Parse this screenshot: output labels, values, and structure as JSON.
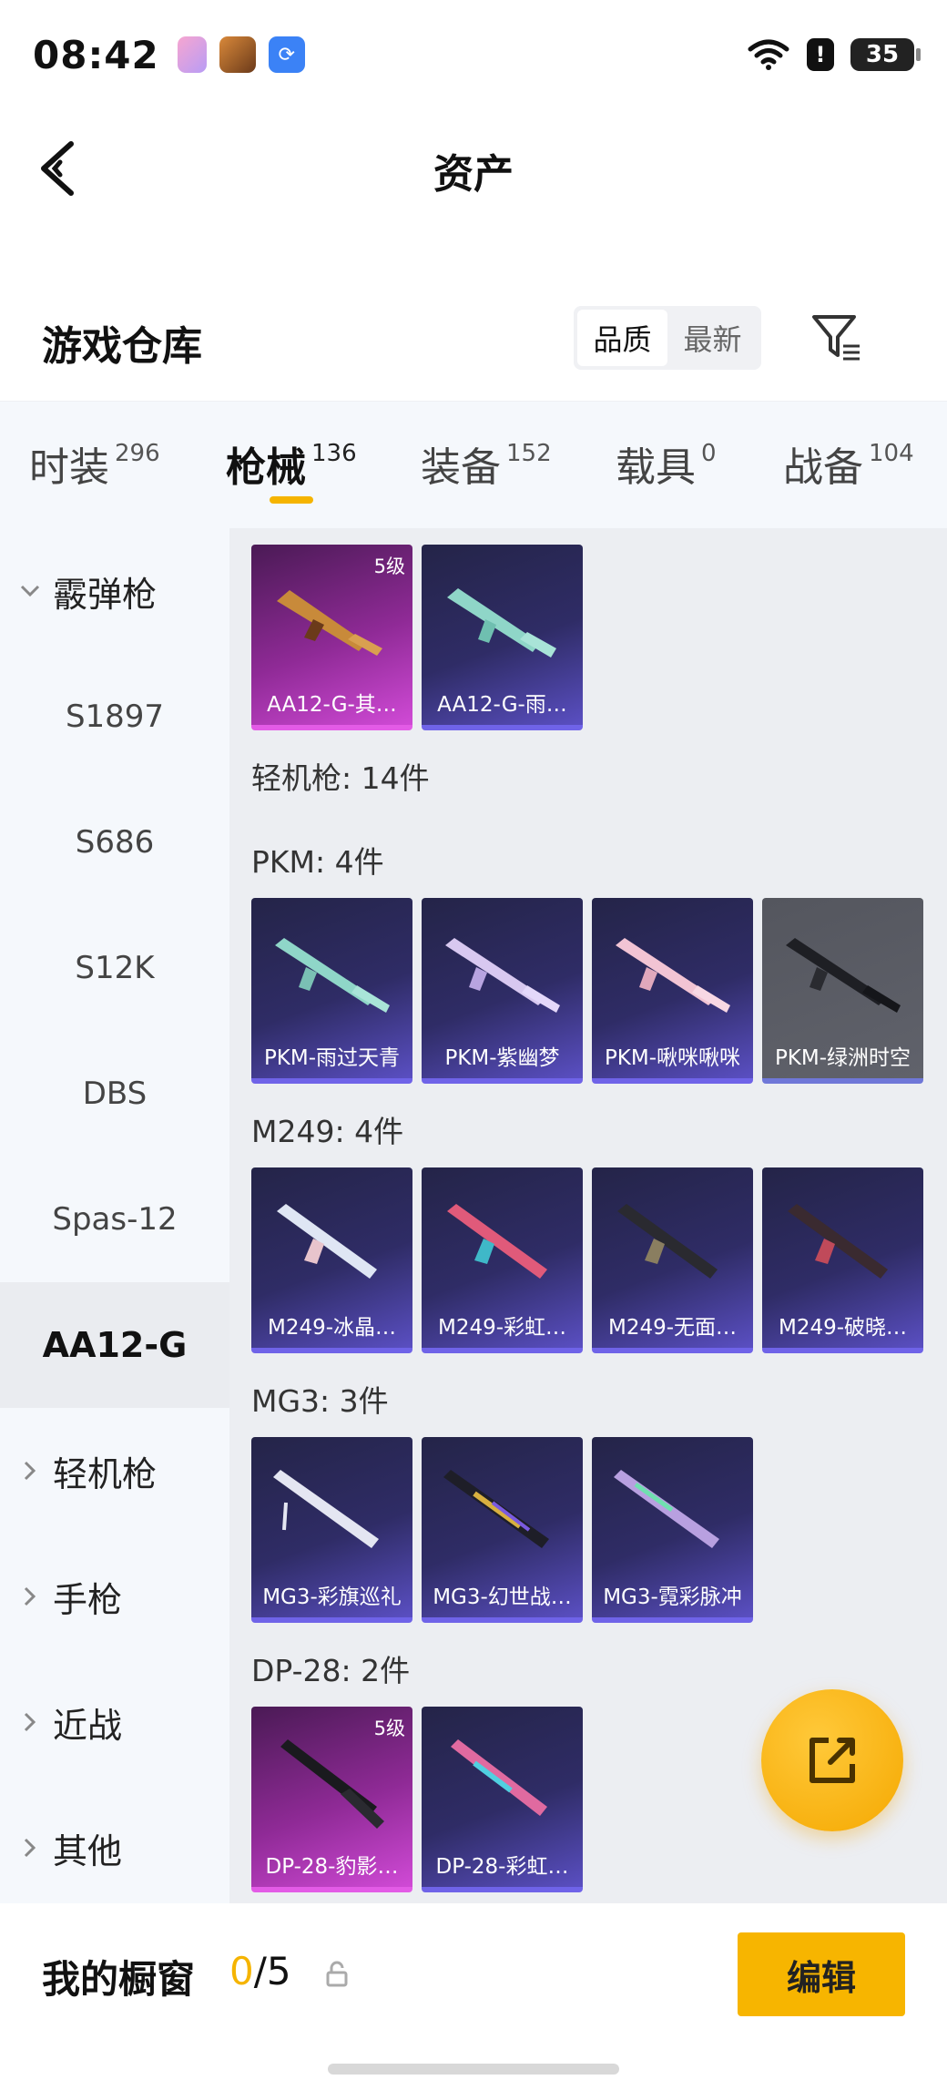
{
  "status_bar": {
    "time": "08:42",
    "battery": "35",
    "icons": [
      "app-icon-1",
      "app-icon-game",
      "app-icon-link",
      "wifi-icon",
      "alert-icon",
      "battery-icon"
    ]
  },
  "header": {
    "title": "资产",
    "back_icon": "back-arrow-icon"
  },
  "warehouse": {
    "title": "游戏仓库",
    "sort_options": [
      "品质",
      "最新"
    ],
    "sort_selected": "品质",
    "filter_icon": "filter-icon"
  },
  "tabs": [
    {
      "label": "时装",
      "count": "296",
      "active": false
    },
    {
      "label": "枪械",
      "count": "136",
      "active": true
    },
    {
      "label": "装备",
      "count": "152",
      "active": false
    },
    {
      "label": "载具",
      "count": "0",
      "active": false
    },
    {
      "label": "战备",
      "count": "104",
      "active": false
    }
  ],
  "sidebar": {
    "group_open": "霰弹枪",
    "items": [
      "S1897",
      "S686",
      "S12K",
      "DBS",
      "Spas-12",
      "AA12-G"
    ],
    "active_item": "AA12-G",
    "groups_closed": [
      "轻机枪",
      "手枪",
      "近战",
      "其他"
    ]
  },
  "content": {
    "aa12_cards": [
      {
        "name": "AA12-G-其…",
        "badge": "5级",
        "tier": "pink"
      },
      {
        "name": "AA12-G-雨…",
        "badge": "",
        "tier": "blue"
      }
    ],
    "lmg_header": "轻机枪: 14件",
    "pkm_header": "PKM: 4件",
    "pkm_cards": [
      {
        "name": "PKM-雨过天青"
      },
      {
        "name": "PKM-紫幽梦"
      },
      {
        "name": "PKM-啾咪啾咪"
      },
      {
        "name": "PKM-绿洲时空"
      }
    ],
    "m249_header": "M249: 4件",
    "m249_cards": [
      {
        "name": "M249-冰晶…"
      },
      {
        "name": "M249-彩虹…"
      },
      {
        "name": "M249-无面…"
      },
      {
        "name": "M249-破晓…"
      }
    ],
    "mg3_header": "MG3: 3件",
    "mg3_cards": [
      {
        "name": "MG3-彩旗巡礼"
      },
      {
        "name": "MG3-幻世战…"
      },
      {
        "name": "MG3-霓彩脉冲"
      }
    ],
    "dp28_header": "DP-28: 2件",
    "dp28_cards": [
      {
        "name": "DP-28-豹影…",
        "badge": "5级"
      },
      {
        "name": "DP-28-彩虹…",
        "badge": ""
      }
    ]
  },
  "fab": {
    "icon": "share-icon"
  },
  "bottom": {
    "showcase_label": "我的橱窗",
    "showcase_current": "0",
    "showcase_sep": "/",
    "showcase_total": "5",
    "edit_label": "编辑"
  },
  "colors": {
    "accent": "#f5b400",
    "card_blue": "#2f2c66",
    "card_pink": "#8f2a96",
    "card_grey": "#60626b"
  }
}
